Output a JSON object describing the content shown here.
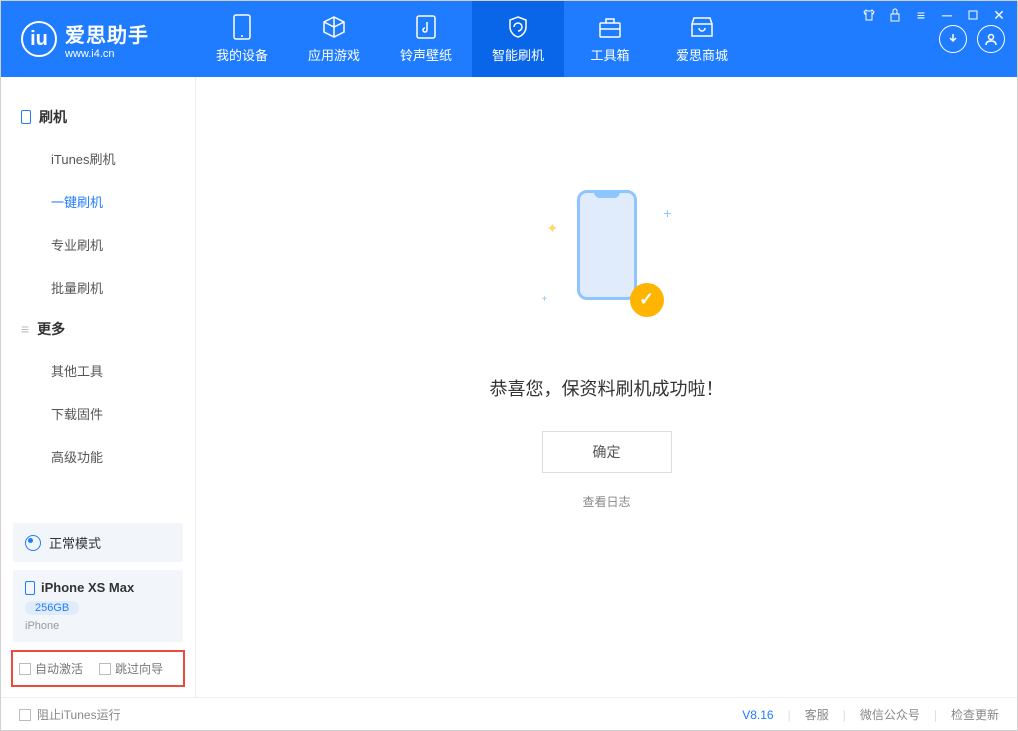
{
  "header": {
    "logo_title": "爱思助手",
    "logo_sub": "www.i4.cn",
    "tabs": [
      {
        "label": "我的设备"
      },
      {
        "label": "应用游戏"
      },
      {
        "label": "铃声壁纸"
      },
      {
        "label": "智能刷机"
      },
      {
        "label": "工具箱"
      },
      {
        "label": "爱思商城"
      }
    ]
  },
  "sidebar": {
    "section1_title": "刷机",
    "items1": [
      {
        "label": "iTunes刷机"
      },
      {
        "label": "一键刷机"
      },
      {
        "label": "专业刷机"
      },
      {
        "label": "批量刷机"
      }
    ],
    "section2_title": "更多",
    "items2": [
      {
        "label": "其他工具"
      },
      {
        "label": "下载固件"
      },
      {
        "label": "高级功能"
      }
    ],
    "mode_label": "正常模式",
    "device_name": "iPhone XS Max",
    "device_storage": "256GB",
    "device_type": "iPhone",
    "option_auto_activate": "自动激活",
    "option_skip_guide": "跳过向导"
  },
  "main": {
    "success_message": "恭喜您，保资料刷机成功啦！",
    "confirm_button": "确定",
    "view_log": "查看日志"
  },
  "footer": {
    "block_itunes": "阻止iTunes运行",
    "version": "V8.16",
    "customer_service": "客服",
    "wechat": "微信公众号",
    "check_update": "检查更新"
  }
}
